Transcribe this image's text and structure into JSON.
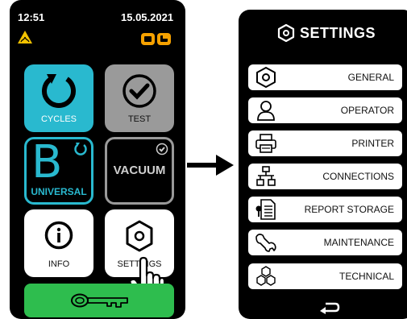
{
  "left_screen": {
    "status": {
      "time": "12:51",
      "date": "15.05.2021"
    },
    "tiles": {
      "cycles": "CYCLES",
      "test": "TEST",
      "universal_letter": "B",
      "universal": "UNIVERSAL",
      "vacuum": "VACUUM",
      "info": "INFO",
      "settings": "SETTINGS"
    }
  },
  "right_screen": {
    "title": "SETTINGS",
    "menu": [
      {
        "label": "GENERAL",
        "icon": "hexagon-icon"
      },
      {
        "label": "OPERATOR",
        "icon": "person-icon"
      },
      {
        "label": "PRINTER",
        "icon": "printer-icon"
      },
      {
        "label": "CONNECTIONS",
        "icon": "network-icon"
      },
      {
        "label": "REPORT STORAGE",
        "icon": "document-icon"
      },
      {
        "label": "MAINTENANCE",
        "icon": "wrench-icon"
      },
      {
        "label": "TECHNICAL",
        "icon": "hexagons-icon"
      }
    ]
  },
  "colors": {
    "cyan": "#29b9cf",
    "grey": "#9a9a9a",
    "green": "#2ebd4e",
    "orange": "#f5a100"
  }
}
